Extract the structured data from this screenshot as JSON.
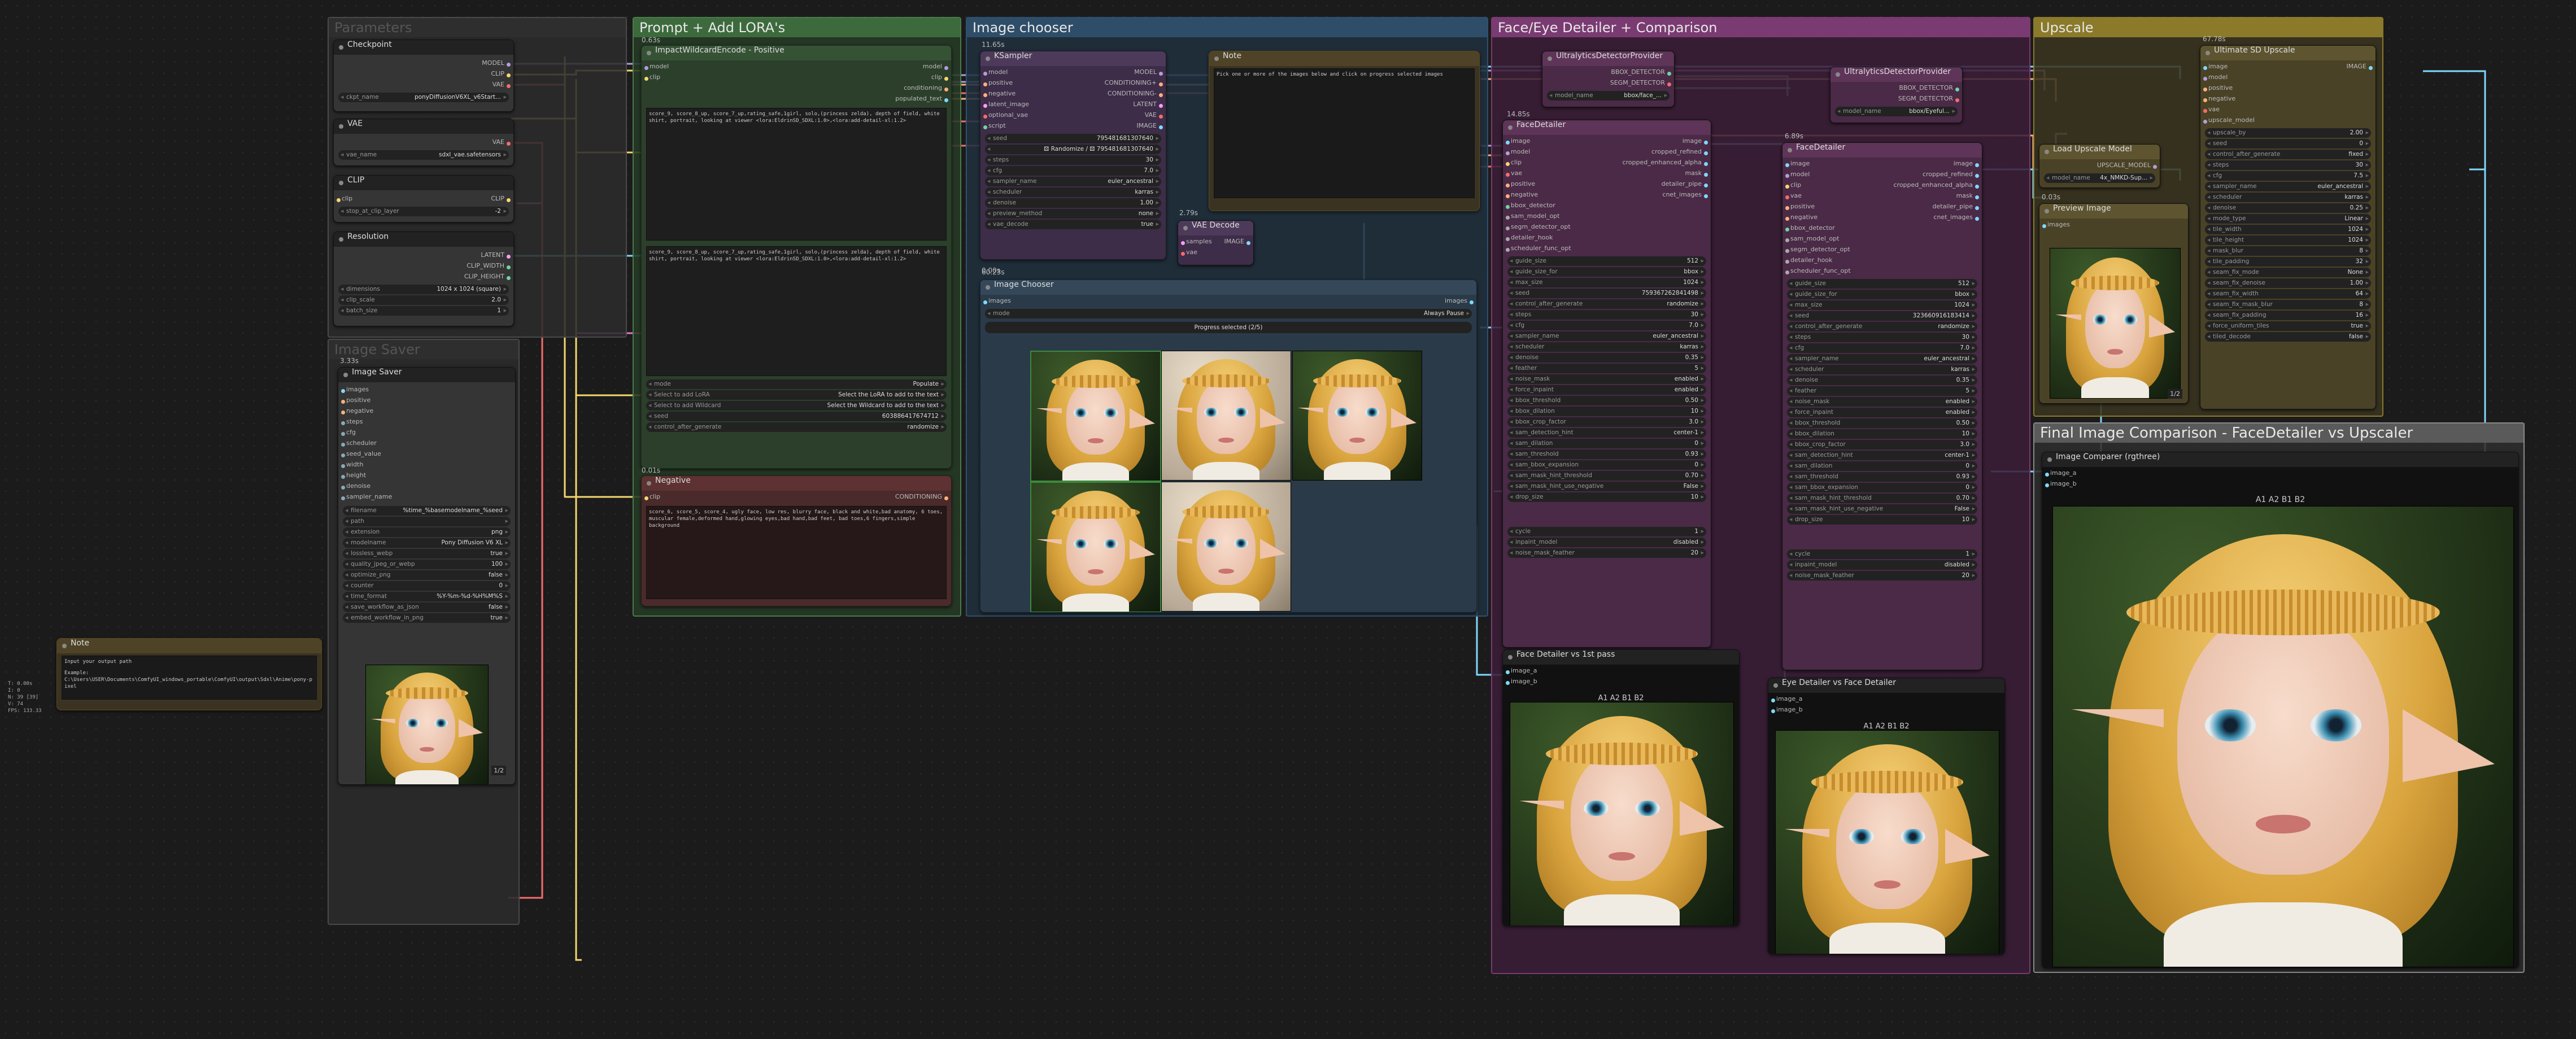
{
  "groups": {
    "parameters": "Parameters",
    "prompt": "Prompt + Add LORA's",
    "chooser": "Image chooser",
    "detailer": "Face/Eye Detailer + Comparison",
    "upscale": "Upscale",
    "final": "Final Image Comparison - FaceDetailer vs Upscaler",
    "saver": "Image Saver"
  },
  "checkpoint": {
    "title": "Checkpoint",
    "out1": "MODEL",
    "out2": "CLIP",
    "out3": "VAE",
    "w_name": "ckpt_name",
    "w_val": "ponyDiffusionV6XL_v6Start..."
  },
  "vae": {
    "title": "VAE",
    "out": "VAE",
    "w_name": "vae_name",
    "w_val": "sdxl_vae.safetensors"
  },
  "clip": {
    "title": "CLIP",
    "in": "clip",
    "out": "CLIP",
    "w_name": "stop_at_clip_layer",
    "w_val": "-2"
  },
  "resolution": {
    "title": "Resolution",
    "o1": "LATENT",
    "o2": "CLIP_WIDTH",
    "o3": "CLIP_HEIGHT",
    "w1": "dimensions",
    "v1": "1024 x 1024 (square)",
    "w2": "clip_scale",
    "v2": "2.0",
    "w3": "batch_size",
    "v3": "1"
  },
  "saverNode": {
    "title": "Image Saver",
    "badge": "3.33s",
    "inputs": [
      "images",
      "positive",
      "negative",
      "steps",
      "cfg",
      "scheduler",
      "seed_value",
      "width",
      "height",
      "denoise",
      "sampler_name"
    ],
    "widgets": [
      [
        "filename",
        "%time_%basemodelname_%seed"
      ],
      [
        "path",
        ""
      ],
      [
        "extension",
        "png"
      ],
      [
        "modelname",
        "Pony Diffusion V6 XL"
      ],
      [
        "lossless_webp",
        "true"
      ],
      [
        "quality_jpeg_or_webp",
        "100"
      ],
      [
        "optimize_png",
        "false"
      ],
      [
        "counter",
        "0"
      ],
      [
        "time_format",
        "%Y-%m-%d-%H%M%S"
      ],
      [
        "save_workflow_as_json",
        "false"
      ],
      [
        "embed_workflow_in_png",
        "true"
      ]
    ],
    "count": "1/2"
  },
  "noteLeft": {
    "title": "Note",
    "text1": "Input your output path",
    "text2": "Example:",
    "text3": "C:\\Users\\USER\\Documents\\ComfyUI_windows_portable\\ComfyUI\\output\\Sdxl\\Anime\\pony-pixel"
  },
  "stats": [
    "T: 0.00s",
    "I: 0",
    "N: 39 [39]",
    "V: 74",
    "FPS: 133.33"
  ],
  "positive": {
    "title": "ImpactWildcardEncode - Positive",
    "badge": "0.63s",
    "in1": "model",
    "in2": "clip",
    "o1": "model",
    "o2": "clip",
    "o3": "conditioning",
    "o4": "populated_text",
    "text1": "score_9, score_8_up, score_7_up,rating_safe,1girl, solo,(princess zelda), depth of field, white shirt, portrait, looking at viewer <lora:EldrinSD_SDXL:1.0>,<lora:add-detail-xl:1.2>",
    "text2": "score_9, score_8_up, score_7_up,rating_safe,1girl, solo,(princess zelda), depth of field, white shirt, portrait, looking at viewer <lora:EldrinSD_SDXL:1.0>,<lora:add-detail-xl:1.2>",
    "mode_n": "mode",
    "mode_v": "Populate",
    "lora": "Select to add LoRA",
    "lora_v": "Select the LoRA to add to the text",
    "wild": "Select to add Wildcard",
    "wild_v": "Select the Wildcard to add to the text",
    "seed_n": "seed",
    "seed_v": "603886417674712",
    "cag_n": "control_after_generate",
    "cag_v": "randomize"
  },
  "negative": {
    "title": "Negative",
    "badge": "0.01s",
    "in": "clip",
    "out": "CONDITIONING",
    "text": "score_6, score_5, score_4, ugly face, low res, blurry face, black and white,bad anatomy, 6 toes, muscular female,deformed hand,glowing eyes,bad hand,bad feet, bad toes,6 fingers,simple background"
  },
  "ksampler": {
    "title": "KSampler",
    "badge": "11.65s",
    "ins": [
      "model",
      "positive",
      "negative",
      "latent_image",
      "optional_vae",
      "script"
    ],
    "outs": [
      "MODEL",
      "CONDITIONING+",
      "CONDITIONING-",
      "LATENT",
      "VAE",
      "IMAGE"
    ],
    "widgets": [
      [
        "seed",
        "795481681307640"
      ],
      [
        "",
        "⚄ Randomize / ⚄ 795481681307640"
      ],
      [
        "steps",
        "30"
      ],
      [
        "cfg",
        "7.0"
      ],
      [
        "sampler_name",
        "euler_ancestral"
      ],
      [
        "scheduler",
        "karras"
      ],
      [
        "denoise",
        "1.00"
      ],
      [
        "preview_method",
        "none"
      ],
      [
        "vae_decode",
        "true"
      ]
    ],
    "badge2": "0.00s"
  },
  "vaedecode": {
    "title": "VAE Decode",
    "badge": "2.79s",
    "in1": "samples",
    "in2": "vae",
    "out": "IMAGE"
  },
  "noteTop": {
    "title": "Note",
    "text": "Pick one or more of the images below and click on progress selected images"
  },
  "imagechooser": {
    "title": "Image Chooser",
    "badge": "60.23s",
    "in": "images",
    "out": "images",
    "mode_n": "mode",
    "mode_v": "Always Pause",
    "btn": "Progress selected (2/5)"
  },
  "ultra1": {
    "title": "UltralyticsDetectorProvider",
    "o1": "BBOX_DETECTOR",
    "o2": "SEGM_DETECTOR",
    "w_n": "model_name",
    "w_v": "bbox/face_..."
  },
  "ultra2": {
    "title": "UltralyticsDetectorProvider",
    "o1": "BBOX_DETECTOR",
    "o2": "SEGM_DETECTOR",
    "w_n": "model_name",
    "w_v": "bbox/Eyeful..."
  },
  "fd1": {
    "title": "FaceDetailer",
    "badge": "14.85s",
    "ins": [
      "image",
      "model",
      "clip",
      "vae",
      "positive",
      "negative",
      "bbox_detector",
      "sam_model_opt",
      "segm_detector_opt",
      "detailer_hook",
      "scheduler_func_opt"
    ],
    "outs": [
      "image",
      "cropped_refined",
      "cropped_enhanced_alpha",
      "mask",
      "detailer_pipe",
      "cnet_images"
    ],
    "widgets": [
      [
        "guide_size",
        "512"
      ],
      [
        "guide_size_for",
        "bbox"
      ],
      [
        "max_size",
        "1024"
      ],
      [
        "seed",
        "759367262841498"
      ],
      [
        "control_after_generate",
        "randomize"
      ],
      [
        "steps",
        "30"
      ],
      [
        "cfg",
        "7.0"
      ],
      [
        "sampler_name",
        "euler_ancestral"
      ],
      [
        "scheduler",
        "karras"
      ],
      [
        "denoise",
        "0.35"
      ],
      [
        "feather",
        "5"
      ],
      [
        "noise_mask",
        "enabled"
      ],
      [
        "force_inpaint",
        "enabled"
      ],
      [
        "bbox_threshold",
        "0.50"
      ],
      [
        "bbox_dilation",
        "10"
      ],
      [
        "bbox_crop_factor",
        "3.0"
      ],
      [
        "sam_detection_hint",
        "center-1"
      ],
      [
        "sam_dilation",
        "0"
      ],
      [
        "sam_threshold",
        "0.93"
      ],
      [
        "sam_bbox_expansion",
        "0"
      ],
      [
        "sam_mask_hint_threshold",
        "0.70"
      ],
      [
        "sam_mask_hint_use_negative",
        "False"
      ],
      [
        "drop_size",
        "10"
      ]
    ],
    "widgets2": [
      [
        "cycle",
        "1"
      ],
      [
        "inpaint_model",
        "disabled"
      ],
      [
        "noise_mask_feather",
        "20"
      ]
    ]
  },
  "fd2": {
    "title": "FaceDetailer",
    "badge": "6.89s",
    "ins": [
      "image",
      "model",
      "clip",
      "vae",
      "positive",
      "negative",
      "bbox_detector",
      "sam_model_opt",
      "segm_detector_opt",
      "detailer_hook",
      "scheduler_func_opt"
    ],
    "outs": [
      "image",
      "cropped_refined",
      "cropped_enhanced_alpha",
      "mask",
      "detailer_pipe",
      "cnet_images"
    ],
    "widgets": [
      [
        "guide_size",
        "512"
      ],
      [
        "guide_size_for",
        "bbox"
      ],
      [
        "max_size",
        "1024"
      ],
      [
        "seed",
        "323660916183414"
      ],
      [
        "control_after_generate",
        "randomize"
      ],
      [
        "steps",
        "30"
      ],
      [
        "cfg",
        "7.0"
      ],
      [
        "sampler_name",
        "euler_ancestral"
      ],
      [
        "scheduler",
        "karras"
      ],
      [
        "denoise",
        "0.35"
      ],
      [
        "feather",
        "5"
      ],
      [
        "noise_mask",
        "enabled"
      ],
      [
        "force_inpaint",
        "enabled"
      ],
      [
        "bbox_threshold",
        "0.50"
      ],
      [
        "bbox_dilation",
        "10"
      ],
      [
        "bbox_crop_factor",
        "3.0"
      ],
      [
        "sam_detection_hint",
        "center-1"
      ],
      [
        "sam_dilation",
        "0"
      ],
      [
        "sam_threshold",
        "0.93"
      ],
      [
        "sam_bbox_expansion",
        "0"
      ],
      [
        "sam_mask_hint_threshold",
        "0.70"
      ],
      [
        "sam_mask_hint_use_negative",
        "False"
      ],
      [
        "drop_size",
        "10"
      ]
    ],
    "widgets2": [
      [
        "cycle",
        "1"
      ],
      [
        "inpaint_model",
        "disabled"
      ],
      [
        "noise_mask_feather",
        "20"
      ]
    ]
  },
  "cmp1": {
    "title": "Face Detailer vs 1st pass",
    "in1": "image_a",
    "in2": "image_b",
    "tabs": "A1 A2 B1 B2"
  },
  "cmp2": {
    "title": "Eye Detailer vs Face Detailer",
    "in1": "image_a",
    "in2": "image_b",
    "tabs": "A1 A2 B1 B2"
  },
  "cmp3": {
    "title": "Image Comparer (rgthree)",
    "in1": "image_a",
    "in2": "image_b",
    "tabs": "A1 A2 B1 B2"
  },
  "loadup": {
    "title": "Load Upscale Model",
    "out": "UPSCALE_MODEL",
    "w_n": "model_name",
    "w_v": "4x_NMKD-Sup..."
  },
  "preview": {
    "title": "Preview Image",
    "badge": "0.03s",
    "in": "images",
    "count": "1/2"
  },
  "usd": {
    "title": "Ultimate SD Upscale",
    "badge": "67.78s",
    "ins": [
      "image",
      "model",
      "positive",
      "negative",
      "vae",
      "upscale_model"
    ],
    "out": "IMAGE",
    "widgets": [
      [
        "upscale_by",
        "2.00"
      ],
      [
        "seed",
        "0"
      ],
      [
        "control_after_generate",
        "fixed"
      ],
      [
        "steps",
        "30"
      ],
      [
        "cfg",
        "7.5"
      ],
      [
        "sampler_name",
        "euler_ancestral"
      ],
      [
        "scheduler",
        "karras"
      ],
      [
        "denoise",
        "0.25"
      ],
      [
        "mode_type",
        "Linear"
      ],
      [
        "tile_width",
        "1024"
      ],
      [
        "tile_height",
        "1024"
      ],
      [
        "mask_blur",
        "8"
      ],
      [
        "tile_padding",
        "32"
      ],
      [
        "seam_fix_mode",
        "None"
      ],
      [
        "seam_fix_denoise",
        "1.00"
      ],
      [
        "seam_fix_width",
        "64"
      ],
      [
        "seam_fix_mask_blur",
        "8"
      ],
      [
        "seam_fix_padding",
        "16"
      ],
      [
        "force_uniform_tiles",
        "true"
      ],
      [
        "tiled_decode",
        "false"
      ]
    ]
  }
}
